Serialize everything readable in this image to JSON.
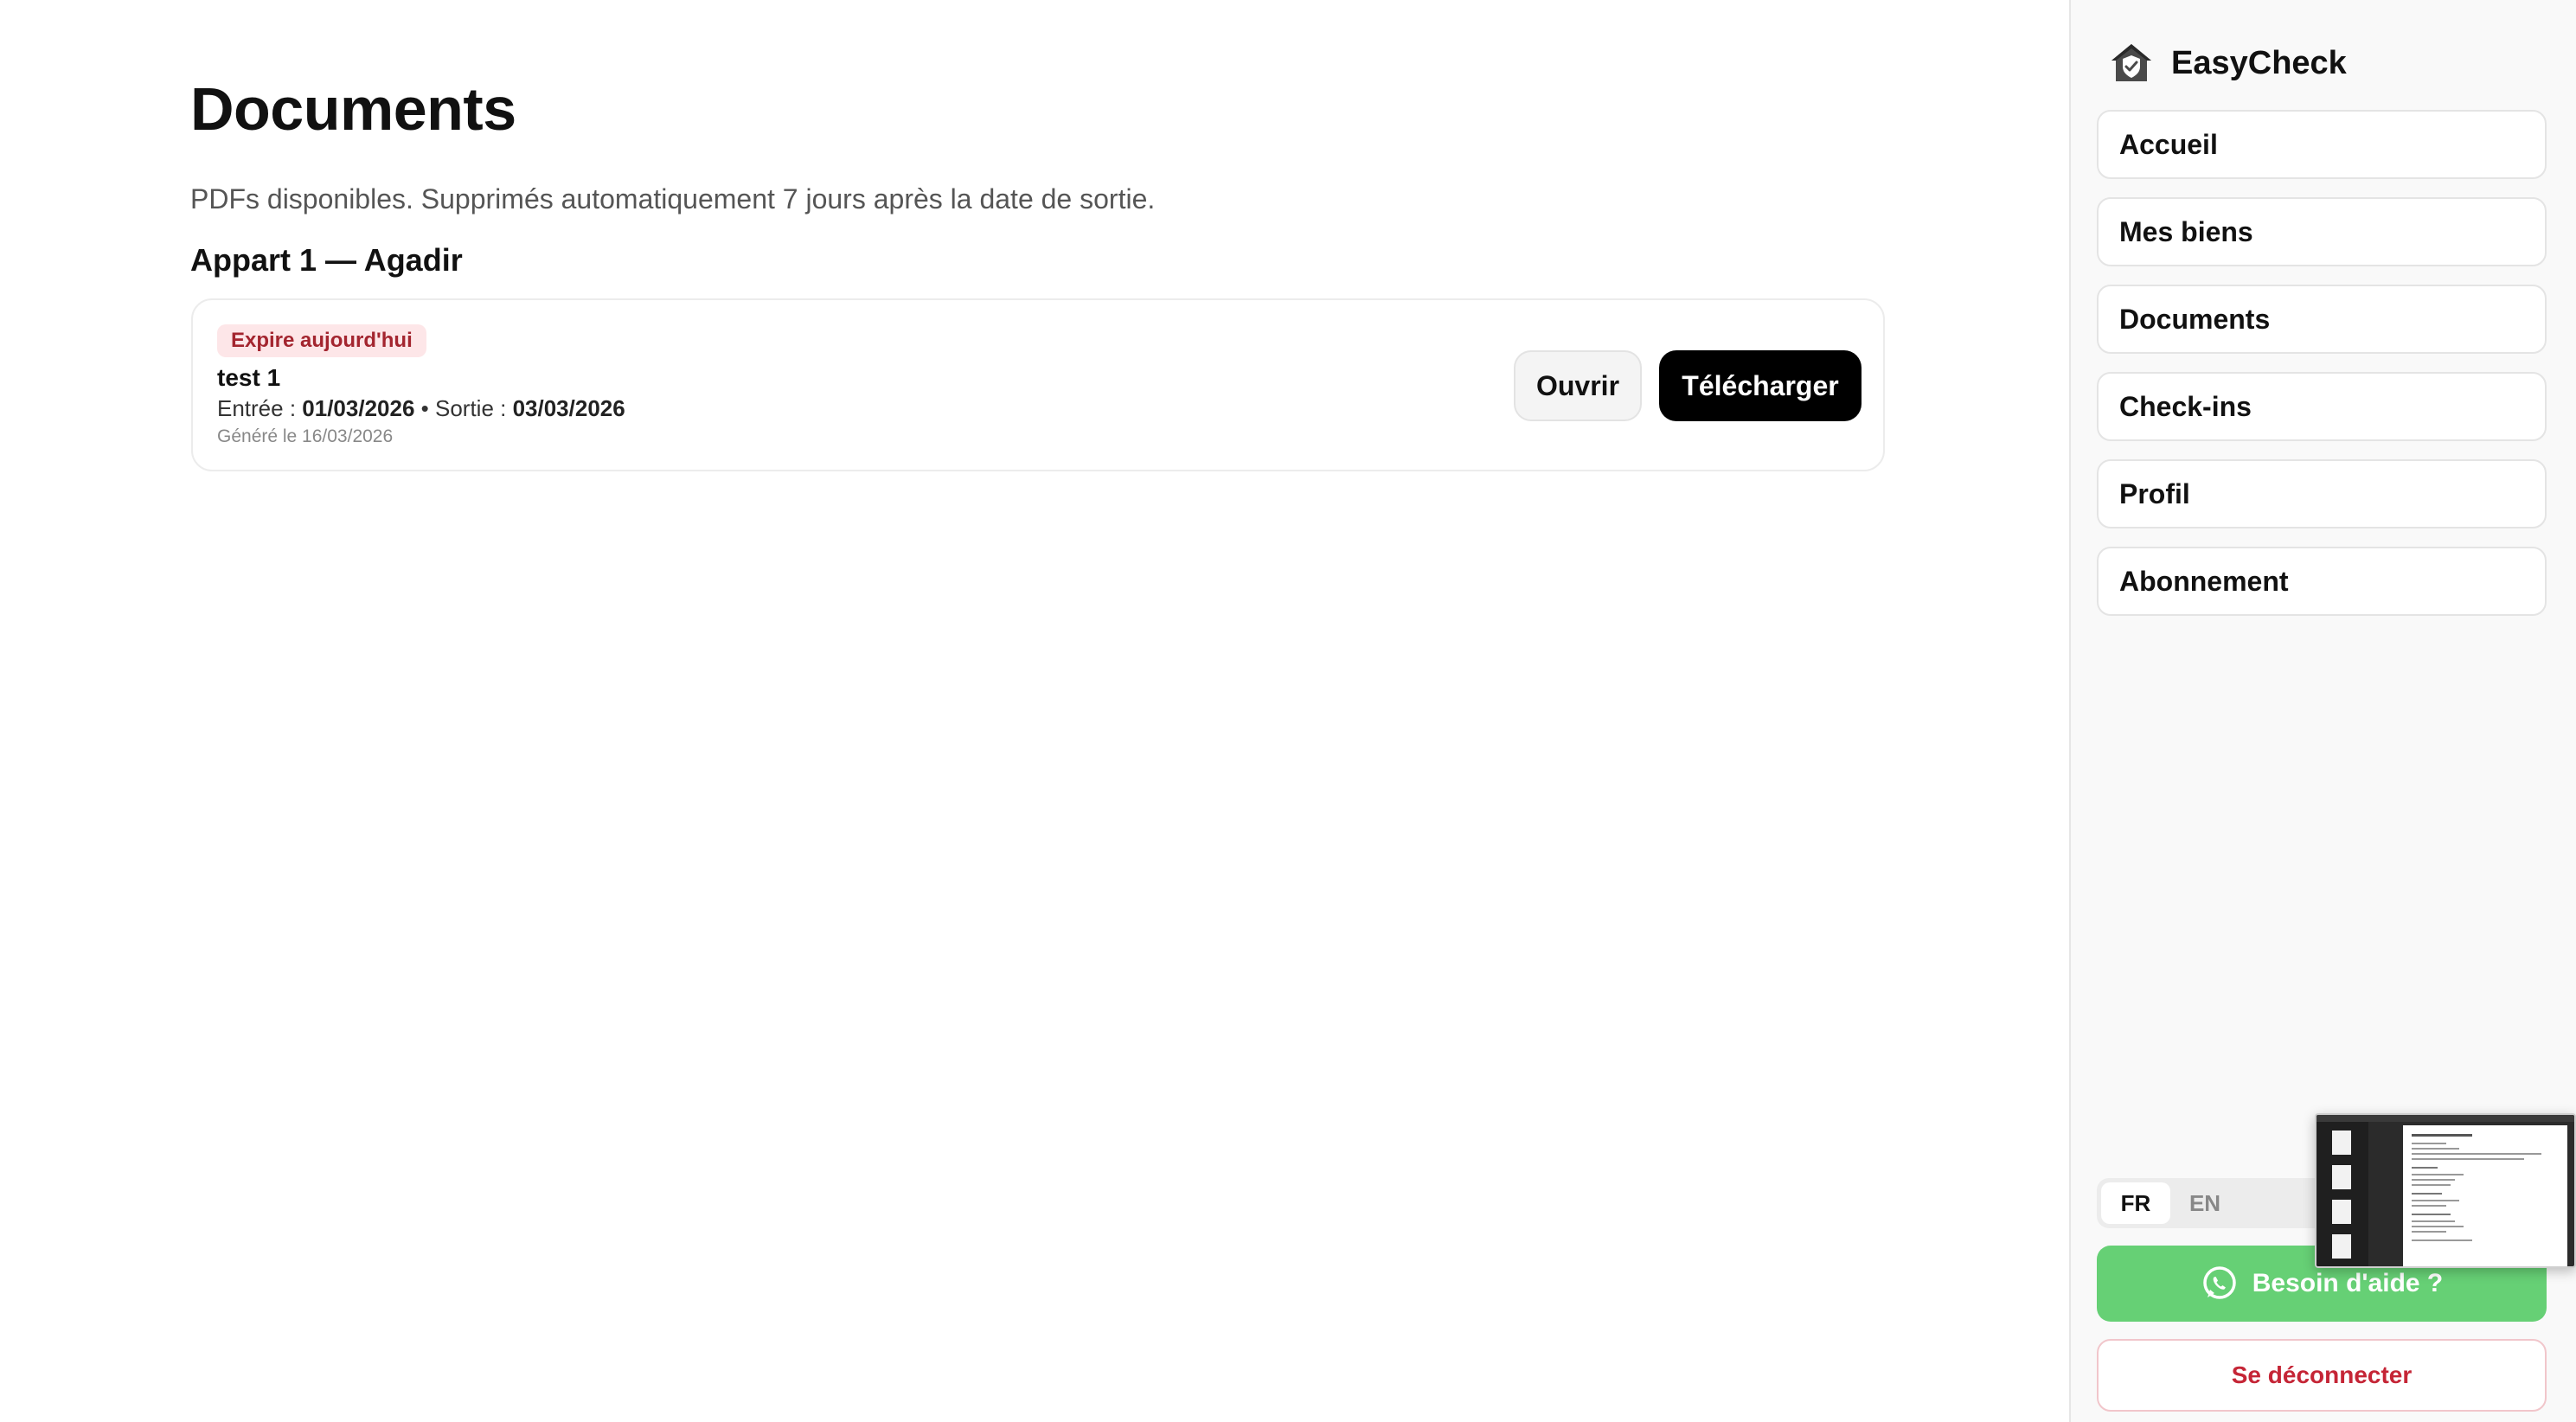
{
  "main": {
    "title": "Documents",
    "subtitle": "PDFs disponibles. Supprimés automatiquement 7 jours après la date de sortie.",
    "sections": [
      {
        "title": "Appart 1 — Agadir",
        "documents": [
          {
            "badge": "Expire aujourd'hui",
            "name": "test 1",
            "entry_label": "Entrée : ",
            "entry_date": "01/03/2026",
            "separator": " • ",
            "exit_label": "Sortie : ",
            "exit_date": "03/03/2026",
            "generated": "Généré le 16/03/2026",
            "open_label": "Ouvrir",
            "download_label": "Télécharger"
          }
        ]
      }
    ]
  },
  "sidebar": {
    "brand": "EasyCheck",
    "brand_icon": "house-shield-icon",
    "items": [
      {
        "label": "Accueil"
      },
      {
        "label": "Mes biens"
      },
      {
        "label": "Documents"
      },
      {
        "label": "Check-ins"
      },
      {
        "label": "Profil"
      },
      {
        "label": "Abonnement"
      }
    ],
    "languages": [
      "FR",
      "EN"
    ],
    "active_language": "FR",
    "help_label": "Besoin d'aide ?",
    "help_icon": "whatsapp-icon",
    "logout_label": "Se déconnecter"
  },
  "colors": {
    "badge_bg": "#fde6e8",
    "badge_text": "#a3252f",
    "primary_button": "#000000",
    "help_green": "#66d075",
    "logout_red": "#c52536"
  }
}
